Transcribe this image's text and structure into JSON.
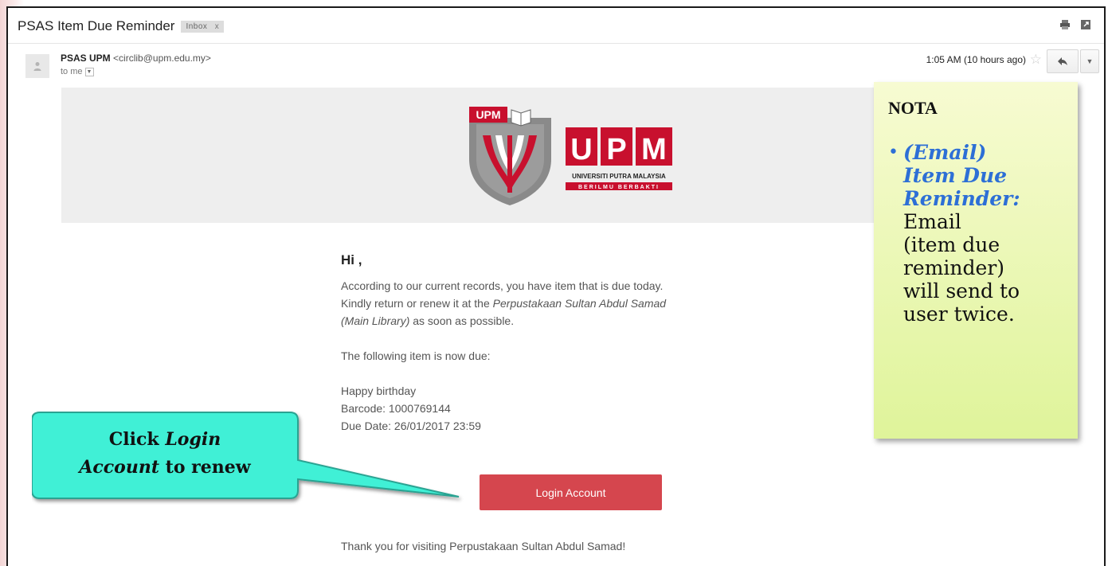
{
  "email": {
    "subject": "PSAS Item Due Reminder",
    "label": "Inbox",
    "label_close": "x",
    "sender_name": "PSAS UPM",
    "sender_email": "<circlib@upm.edu.my>",
    "recipient": "to me",
    "time": "1:05 AM (10 hours ago)",
    "logo": {
      "badge_text": "UPM",
      "wordmark": "UPM",
      "university": "UNIVERSITI PUTRA MALAYSIA",
      "motto": "BERILMU BERBAKTI"
    },
    "greeting": "Hi ,",
    "para1_a": "According to our current records, you have item that is due today.",
    "para1_b": "Kindly return or renew it at the ",
    "para1_library": "Perpustakaan Sultan Abdul Samad",
    "para1_library2": "(Main Library)",
    "para1_c": " as soon as possible.",
    "para2": "The following item is now due:",
    "item_title": "Happy birthday",
    "barcode": "Barcode: 1000769144",
    "due_date": "Due Date: 26/01/2017 23:59",
    "login_button": "Login Account",
    "thanks": "Thank you for visiting Perpustakaan Sultan Abdul Samad!"
  },
  "nota": {
    "title": "NOTA",
    "em_line1": "(Email)",
    "em_line2": "Item Due",
    "em_line3": "Reminder:",
    "text_lines": [
      "Email",
      "(item due",
      "reminder)",
      "will send to",
      "user twice."
    ]
  },
  "callout": {
    "line1_a": "Click ",
    "line1_b": "Login",
    "line2_a": "Account",
    "line2_b": " to renew"
  },
  "icons": {
    "print": "print-icon",
    "new_window": "new-window-icon",
    "star": "star-icon",
    "reply": "reply-icon",
    "more": "chevron-down-icon",
    "avatar": "person-icon"
  },
  "colors": {
    "button": "#d5464e",
    "upm_red": "#c8102e",
    "nota_accent": "#2d6fd6",
    "callout_fill": "#3ff0d6"
  }
}
